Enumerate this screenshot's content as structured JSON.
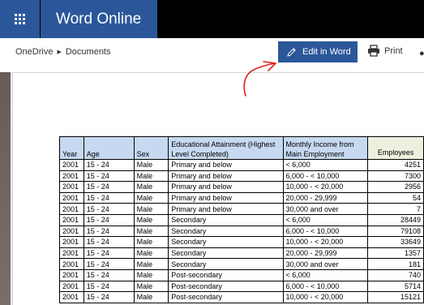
{
  "app": {
    "title": "Word Online"
  },
  "breadcrumb": {
    "items": [
      "OneDrive",
      "Documents"
    ]
  },
  "toolbar": {
    "edit_label": "Edit in Word",
    "print_label": "Print"
  },
  "colors": {
    "brand": "#2b579a",
    "annotation": "#e0201c",
    "header_blue": "#c6d9f1",
    "header_green": "#ebf1de"
  },
  "table": {
    "headers": [
      "Year",
      "Age",
      "Sex",
      "Educational Attainment (Highest Level Completed)",
      "Monthly Income from Main Employment",
      "Employees"
    ],
    "rows": [
      [
        "2001",
        "15 - 24",
        "Male",
        "Primary and below",
        "< 6,000",
        "4251"
      ],
      [
        "2001",
        "15 - 24",
        "Male",
        "Primary and below",
        "6,000 - < 10,000",
        "7300"
      ],
      [
        "2001",
        "15 - 24",
        "Male",
        "Primary and below",
        "10,000 - < 20,000",
        "2956"
      ],
      [
        "2001",
        "15 - 24",
        "Male",
        "Primary and below",
        "20,000 - 29,999",
        "54"
      ],
      [
        "2001",
        "15 - 24",
        "Male",
        "Primary and below",
        "30,000 and over",
        "7"
      ],
      [
        "2001",
        "15 - 24",
        "Male",
        "Secondary",
        "< 6,000",
        "28449"
      ],
      [
        "2001",
        "15 - 24",
        "Male",
        "Secondary",
        "6,000 - < 10,000",
        "79108"
      ],
      [
        "2001",
        "15 - 24",
        "Male",
        "Secondary",
        "10,000 - < 20,000",
        "33649"
      ],
      [
        "2001",
        "15 - 24",
        "Male",
        "Secondary",
        "20,000 - 29,999",
        "1357"
      ],
      [
        "2001",
        "15 - 24",
        "Male",
        "Secondary",
        "30,000 and over",
        "181"
      ],
      [
        "2001",
        "15 - 24",
        "Male",
        "Post-secondary",
        "< 6,000",
        "740"
      ],
      [
        "2001",
        "15 - 24",
        "Male",
        "Post-secondary",
        "6,000 - < 10,000",
        "5714"
      ],
      [
        "2001",
        "15 - 24",
        "Male",
        "Post-secondary",
        "10,000 - < 20,000",
        "15121"
      ]
    ]
  }
}
